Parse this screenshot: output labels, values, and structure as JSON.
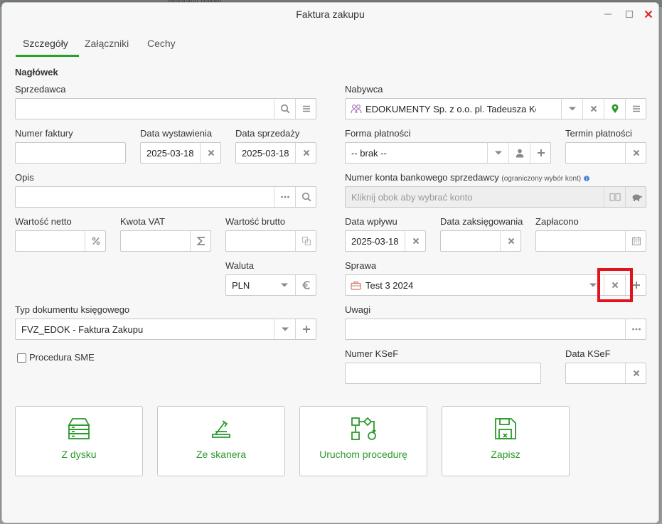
{
  "background": {
    "text": "Wybrany pakiet"
  },
  "window": {
    "title": "Faktura zakupu"
  },
  "tabs": [
    {
      "label": "Szczegóły",
      "active": true
    },
    {
      "label": "Załączniki",
      "active": false
    },
    {
      "label": "Cechy",
      "active": false
    }
  ],
  "section_heading": "Nagłówek",
  "left": {
    "seller": {
      "label": "Sprzedawca",
      "value": ""
    },
    "invoice_number": {
      "label": "Numer faktury",
      "value": ""
    },
    "issue_date": {
      "label": "Data wystawienia",
      "value": "2025-03-18"
    },
    "sale_date": {
      "label": "Data sprzedaży",
      "value": "2025-03-18"
    },
    "description": {
      "label": "Opis",
      "value": ""
    },
    "net_value": {
      "label": "Wartość netto",
      "value": ""
    },
    "vat_amount": {
      "label": "Kwota VAT",
      "value": ""
    },
    "gross_value": {
      "label": "Wartość brutto",
      "value": ""
    },
    "currency": {
      "label": "Waluta",
      "value": "PLN"
    },
    "accounting_doc_type": {
      "label": "Typ dokumentu księgowego",
      "value": "FVZ_EDOK - Faktura Zakupu"
    },
    "sme_procedure": {
      "label": "Procedura SME",
      "checked": false
    }
  },
  "right": {
    "buyer": {
      "label": "Nabywca",
      "value": "EDOKUMENTY Sp. z o.o. pl. Tadeusza Kości..."
    },
    "payment_form": {
      "label": "Forma płatności",
      "value": "-- brak --"
    },
    "payment_term": {
      "label": "Termin płatności",
      "value": ""
    },
    "bank_account": {
      "label": "Numer konta bankowego sprzedawcy",
      "note": "(ograniczony wybór kont)",
      "placeholder": "Kliknij obok aby wybrać konto"
    },
    "receipt_date": {
      "label": "Data wpływu",
      "value": "2025-03-18"
    },
    "posting_date": {
      "label": "Data zaksięgowania",
      "value": ""
    },
    "paid": {
      "label": "Zapłacono",
      "value": ""
    },
    "case": {
      "label": "Sprawa",
      "value": "Test 3 2024"
    },
    "remarks": {
      "label": "Uwagi",
      "value": ""
    },
    "ksef_number": {
      "label": "Numer KSeF",
      "value": ""
    },
    "ksef_date": {
      "label": "Data KSeF",
      "value": ""
    }
  },
  "actions": [
    {
      "label": "Z dysku",
      "icon": "disk-drive-icon"
    },
    {
      "label": "Ze skanera",
      "icon": "scanner-icon"
    },
    {
      "label": "Uruchom procedurę",
      "icon": "workflow-icon"
    },
    {
      "label": "Zapisz",
      "icon": "save-icon"
    }
  ],
  "colors": {
    "accent": "#2aa02a",
    "highlight": "#e0141c",
    "close": "#dd2222"
  }
}
